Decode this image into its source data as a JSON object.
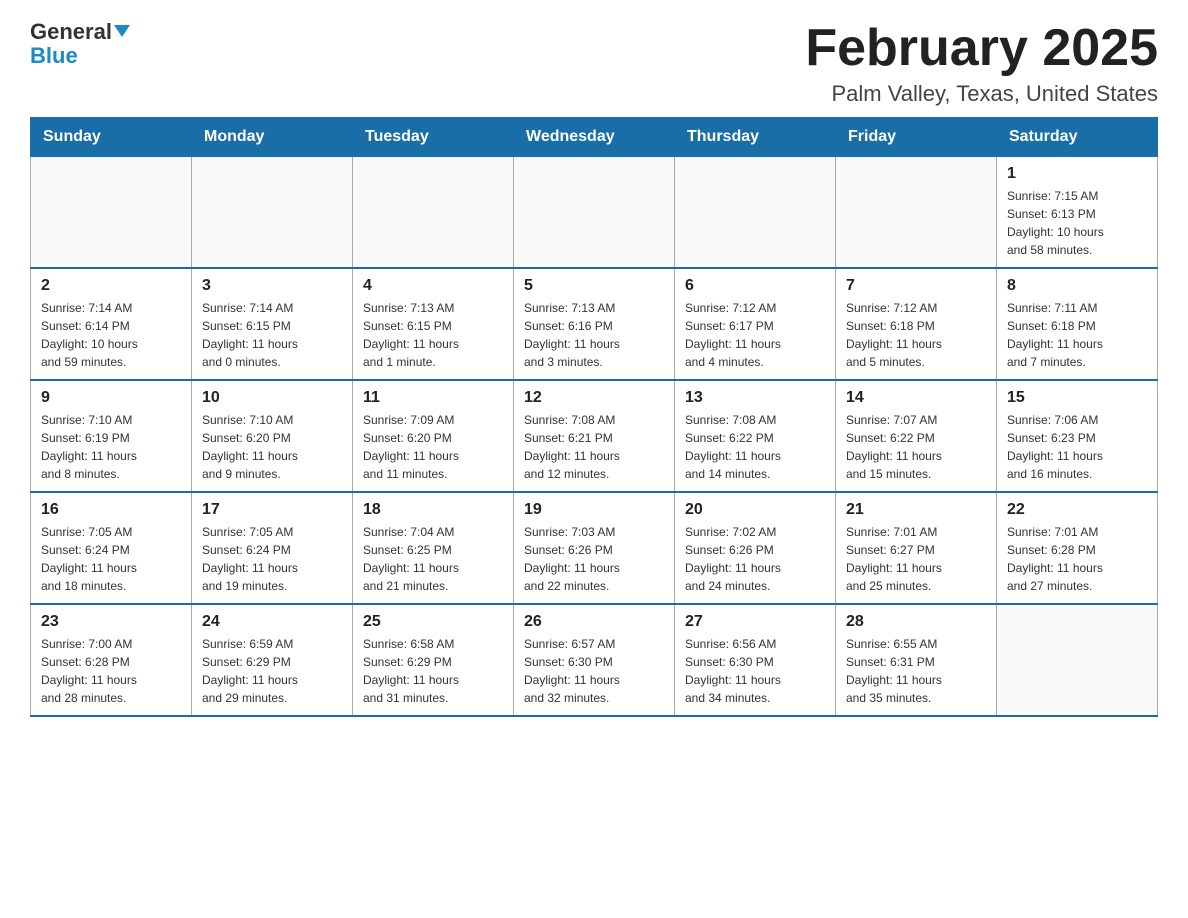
{
  "header": {
    "logo_general": "General",
    "logo_blue": "Blue",
    "title": "February 2025",
    "subtitle": "Palm Valley, Texas, United States"
  },
  "days_of_week": [
    "Sunday",
    "Monday",
    "Tuesday",
    "Wednesday",
    "Thursday",
    "Friday",
    "Saturday"
  ],
  "weeks": [
    [
      {
        "day": "",
        "info": ""
      },
      {
        "day": "",
        "info": ""
      },
      {
        "day": "",
        "info": ""
      },
      {
        "day": "",
        "info": ""
      },
      {
        "day": "",
        "info": ""
      },
      {
        "day": "",
        "info": ""
      },
      {
        "day": "1",
        "info": "Sunrise: 7:15 AM\nSunset: 6:13 PM\nDaylight: 10 hours\nand 58 minutes."
      }
    ],
    [
      {
        "day": "2",
        "info": "Sunrise: 7:14 AM\nSunset: 6:14 PM\nDaylight: 10 hours\nand 59 minutes."
      },
      {
        "day": "3",
        "info": "Sunrise: 7:14 AM\nSunset: 6:15 PM\nDaylight: 11 hours\nand 0 minutes."
      },
      {
        "day": "4",
        "info": "Sunrise: 7:13 AM\nSunset: 6:15 PM\nDaylight: 11 hours\nand 1 minute."
      },
      {
        "day": "5",
        "info": "Sunrise: 7:13 AM\nSunset: 6:16 PM\nDaylight: 11 hours\nand 3 minutes."
      },
      {
        "day": "6",
        "info": "Sunrise: 7:12 AM\nSunset: 6:17 PM\nDaylight: 11 hours\nand 4 minutes."
      },
      {
        "day": "7",
        "info": "Sunrise: 7:12 AM\nSunset: 6:18 PM\nDaylight: 11 hours\nand 5 minutes."
      },
      {
        "day": "8",
        "info": "Sunrise: 7:11 AM\nSunset: 6:18 PM\nDaylight: 11 hours\nand 7 minutes."
      }
    ],
    [
      {
        "day": "9",
        "info": "Sunrise: 7:10 AM\nSunset: 6:19 PM\nDaylight: 11 hours\nand 8 minutes."
      },
      {
        "day": "10",
        "info": "Sunrise: 7:10 AM\nSunset: 6:20 PM\nDaylight: 11 hours\nand 9 minutes."
      },
      {
        "day": "11",
        "info": "Sunrise: 7:09 AM\nSunset: 6:20 PM\nDaylight: 11 hours\nand 11 minutes."
      },
      {
        "day": "12",
        "info": "Sunrise: 7:08 AM\nSunset: 6:21 PM\nDaylight: 11 hours\nand 12 minutes."
      },
      {
        "day": "13",
        "info": "Sunrise: 7:08 AM\nSunset: 6:22 PM\nDaylight: 11 hours\nand 14 minutes."
      },
      {
        "day": "14",
        "info": "Sunrise: 7:07 AM\nSunset: 6:22 PM\nDaylight: 11 hours\nand 15 minutes."
      },
      {
        "day": "15",
        "info": "Sunrise: 7:06 AM\nSunset: 6:23 PM\nDaylight: 11 hours\nand 16 minutes."
      }
    ],
    [
      {
        "day": "16",
        "info": "Sunrise: 7:05 AM\nSunset: 6:24 PM\nDaylight: 11 hours\nand 18 minutes."
      },
      {
        "day": "17",
        "info": "Sunrise: 7:05 AM\nSunset: 6:24 PM\nDaylight: 11 hours\nand 19 minutes."
      },
      {
        "day": "18",
        "info": "Sunrise: 7:04 AM\nSunset: 6:25 PM\nDaylight: 11 hours\nand 21 minutes."
      },
      {
        "day": "19",
        "info": "Sunrise: 7:03 AM\nSunset: 6:26 PM\nDaylight: 11 hours\nand 22 minutes."
      },
      {
        "day": "20",
        "info": "Sunrise: 7:02 AM\nSunset: 6:26 PM\nDaylight: 11 hours\nand 24 minutes."
      },
      {
        "day": "21",
        "info": "Sunrise: 7:01 AM\nSunset: 6:27 PM\nDaylight: 11 hours\nand 25 minutes."
      },
      {
        "day": "22",
        "info": "Sunrise: 7:01 AM\nSunset: 6:28 PM\nDaylight: 11 hours\nand 27 minutes."
      }
    ],
    [
      {
        "day": "23",
        "info": "Sunrise: 7:00 AM\nSunset: 6:28 PM\nDaylight: 11 hours\nand 28 minutes."
      },
      {
        "day": "24",
        "info": "Sunrise: 6:59 AM\nSunset: 6:29 PM\nDaylight: 11 hours\nand 29 minutes."
      },
      {
        "day": "25",
        "info": "Sunrise: 6:58 AM\nSunset: 6:29 PM\nDaylight: 11 hours\nand 31 minutes."
      },
      {
        "day": "26",
        "info": "Sunrise: 6:57 AM\nSunset: 6:30 PM\nDaylight: 11 hours\nand 32 minutes."
      },
      {
        "day": "27",
        "info": "Sunrise: 6:56 AM\nSunset: 6:30 PM\nDaylight: 11 hours\nand 34 minutes."
      },
      {
        "day": "28",
        "info": "Sunrise: 6:55 AM\nSunset: 6:31 PM\nDaylight: 11 hours\nand 35 minutes."
      },
      {
        "day": "",
        "info": ""
      }
    ]
  ]
}
